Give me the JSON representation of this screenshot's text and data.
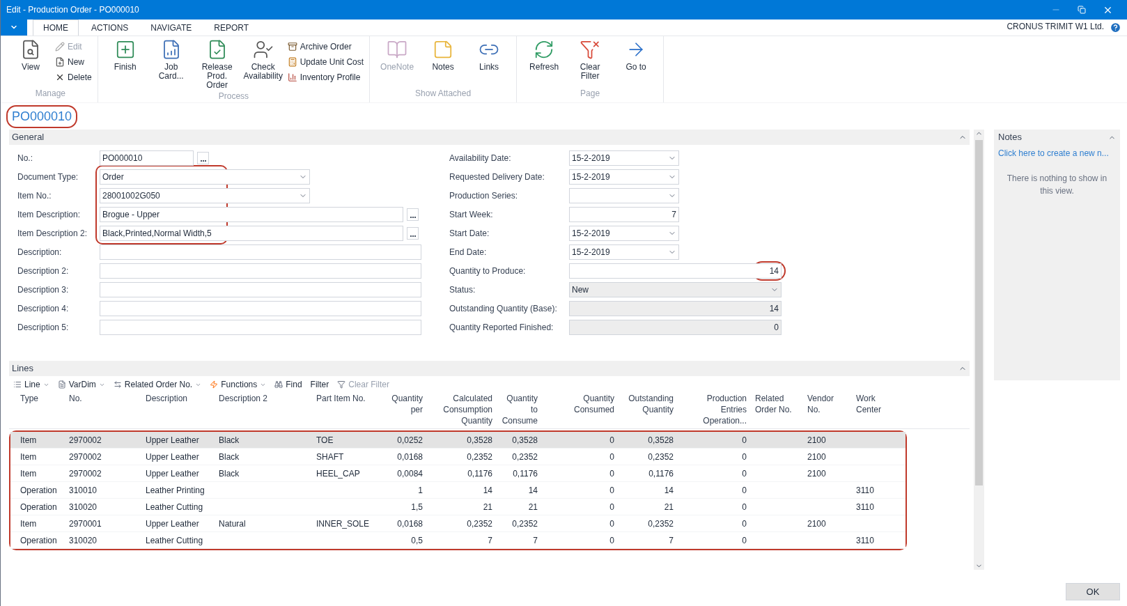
{
  "window": {
    "title": "Edit - Production Order - PO000010",
    "company": "CRONUS TRIMIT W1 Ltd."
  },
  "tabs": [
    {
      "label": "HOME",
      "selected": true
    },
    {
      "label": "ACTIONS",
      "selected": false
    },
    {
      "label": "NAVIGATE",
      "selected": false
    },
    {
      "label": "REPORT",
      "selected": false
    }
  ],
  "ribbon": [
    {
      "label": "Manage",
      "items": [
        {
          "kind": "large",
          "label": "View",
          "disabled": false
        },
        {
          "kind": "small",
          "label": "Edit",
          "disabled": true
        },
        {
          "kind": "small",
          "label": "New",
          "disabled": false
        },
        {
          "kind": "small",
          "label": "Delete",
          "disabled": false
        }
      ]
    },
    {
      "label": "Process",
      "items": [
        {
          "kind": "large",
          "label": "Finish",
          "disabled": false
        },
        {
          "kind": "large",
          "label": "Job Card...",
          "disabled": false
        },
        {
          "kind": "large",
          "label": "Release Prod. Order",
          "disabled": false
        },
        {
          "kind": "large",
          "label": "Check Availability",
          "disabled": false
        },
        {
          "kind": "small",
          "label": "Archive Order",
          "disabled": false
        },
        {
          "kind": "small",
          "label": "Update Unit Cost",
          "disabled": false
        },
        {
          "kind": "small",
          "label": "Inventory Profile",
          "disabled": false
        }
      ]
    },
    {
      "label": "Show Attached",
      "items": [
        {
          "kind": "large",
          "label": "OneNote",
          "disabled": true
        },
        {
          "kind": "large",
          "label": "Notes",
          "disabled": false
        },
        {
          "kind": "large",
          "label": "Links",
          "disabled": false
        }
      ]
    },
    {
      "label": "Page",
      "items": [
        {
          "kind": "large",
          "label": "Refresh",
          "disabled": false
        },
        {
          "kind": "large",
          "label": "Clear Filter",
          "disabled": false
        },
        {
          "kind": "large",
          "label": "Go to",
          "disabled": false
        }
      ]
    }
  ],
  "header": {
    "title": "PO000010",
    "highlighted": true
  },
  "general": {
    "title": "General",
    "left_fields": [
      {
        "label": "No.:",
        "value": "PO000010",
        "kind": "lookup_short",
        "highlighted": false
      },
      {
        "label": "Document Type:",
        "value": "Order",
        "kind": "dropdown",
        "highlighted": true
      },
      {
        "label": "Item No.:",
        "value": "28001002G050",
        "kind": "dropdown",
        "highlighted": true
      },
      {
        "label": "Item Description:",
        "value": "Brogue - Upper",
        "kind": "lookup",
        "highlighted": true
      },
      {
        "label": "Item Description 2:",
        "value": "Black,Printed,Normal Width,5",
        "kind": "lookup",
        "highlighted": true
      },
      {
        "label": "Description:",
        "kind": "text",
        "highlighted": false
      },
      {
        "label": "Description 2:",
        "kind": "text",
        "highlighted": false
      },
      {
        "label": "Description 3:",
        "kind": "text",
        "highlighted": false
      },
      {
        "label": "Description 4:",
        "kind": "text",
        "highlighted": false
      },
      {
        "label": "Description 5:",
        "kind": "text",
        "highlighted": false
      }
    ],
    "right_fields": [
      {
        "label": "Availability Date:",
        "value": "15-2-2019",
        "kind": "date",
        "highlighted": false
      },
      {
        "label": "Requested Delivery Date:",
        "value": "15-2-2019",
        "kind": "date",
        "highlighted": false
      },
      {
        "label": "Production Series:",
        "kind": "date",
        "highlighted": false
      },
      {
        "label": "Start Week:",
        "value": "7",
        "kind": "number",
        "highlighted": false
      },
      {
        "label": "Start Date:",
        "value": "15-2-2019",
        "kind": "date",
        "highlighted": false
      },
      {
        "label": "End Date:",
        "value": "15-2-2019",
        "kind": "date",
        "highlighted": false
      },
      {
        "label": "Quantity to Produce:",
        "value": "14",
        "kind": "quantity",
        "highlighted": true
      },
      {
        "label": "Status:",
        "value": "New",
        "kind": "readonly_dropdown",
        "highlighted": false
      },
      {
        "label": "Outstanding Quantity (Base):",
        "value": "14",
        "kind": "readonly_number",
        "highlighted": false
      },
      {
        "label": "Quantity Reported Finished:",
        "value": "0",
        "kind": "readonly_number",
        "highlighted": false
      }
    ]
  },
  "lines": {
    "title": "Lines",
    "highlighted": true,
    "toolbar": [
      {
        "label": "Line",
        "menu": true,
        "disabled": false
      },
      {
        "label": "VarDim",
        "menu": true,
        "disabled": false
      },
      {
        "label": "Related Order No.",
        "menu": true,
        "disabled": false
      },
      {
        "label": "Functions",
        "menu": true,
        "disabled": false
      },
      {
        "label": "Find",
        "menu": false,
        "disabled": false
      },
      {
        "label": "Filter",
        "menu": false,
        "disabled": false
      },
      {
        "label": "Clear Filter",
        "menu": false,
        "disabled": true
      }
    ],
    "columns": [
      {
        "label": "Type",
        "kind": "text"
      },
      {
        "label": "No.",
        "kind": "text"
      },
      {
        "label": "Description",
        "kind": "text"
      },
      {
        "label": "Description 2",
        "kind": "text"
      },
      {
        "label": "Part Item No.",
        "kind": "text"
      },
      {
        "label": "Quantity per",
        "kind": "number"
      },
      {
        "label": "Calculated Consumption Quantity",
        "kind": "number"
      },
      {
        "label": "Quantity to Consume",
        "kind": "number"
      },
      {
        "label": "Quantity Consumed",
        "kind": "number"
      },
      {
        "label": "Outstanding Quantity",
        "kind": "number"
      },
      {
        "label": "Production Entries Operation...",
        "kind": "number"
      },
      {
        "label": "Related Order No.",
        "kind": "text"
      },
      {
        "label": "Vendor No.",
        "kind": "text"
      },
      {
        "label": "Work Center",
        "kind": "text"
      }
    ],
    "rows": [
      {
        "selected": true,
        "cells": [
          "Item",
          "2970002",
          "Upper Leather",
          "Black",
          "TOE",
          "0,0252",
          "0,3528",
          "0,3528",
          "0",
          "0,3528",
          "0",
          "",
          "2100",
          ""
        ]
      },
      {
        "selected": false,
        "cells": [
          "Item",
          "2970002",
          "Upper Leather",
          "Black",
          "SHAFT",
          "0,0168",
          "0,2352",
          "0,2352",
          "0",
          "0,2352",
          "0",
          "",
          "2100",
          ""
        ]
      },
      {
        "selected": false,
        "cells": [
          "Item",
          "2970002",
          "Upper Leather",
          "Black",
          "HEEL_CAP",
          "0,0084",
          "0,1176",
          "0,1176",
          "0",
          "0,1176",
          "0",
          "",
          "2100",
          ""
        ]
      },
      {
        "selected": false,
        "cells": [
          "Operation",
          "310010",
          "Leather Printing",
          "",
          "",
          "1",
          "14",
          "14",
          "0",
          "14",
          "0",
          "",
          "",
          "3110"
        ]
      },
      {
        "selected": false,
        "cells": [
          "Operation",
          "310020",
          "Leather Cutting",
          "",
          "",
          "1,5",
          "21",
          "21",
          "0",
          "21",
          "0",
          "",
          "",
          "3110"
        ]
      },
      {
        "selected": false,
        "cells": [
          "Item",
          "2970001",
          "Upper Leather",
          "Natural",
          "INNER_SOLE",
          "0,0168",
          "0,2352",
          "0,2352",
          "0",
          "0,2352",
          "0",
          "",
          "2100",
          ""
        ]
      },
      {
        "selected": false,
        "cells": [
          "Operation",
          "310020",
          "Leather Cutting",
          "",
          "",
          "0,5",
          "7",
          "7",
          "0",
          "7",
          "0",
          "",
          "",
          "3110"
        ]
      }
    ]
  },
  "notes": {
    "title": "Notes",
    "link": "Click here to create a new n...",
    "empty_text": "There is nothing to show in this view."
  },
  "buttons": [
    "OK"
  ]
}
